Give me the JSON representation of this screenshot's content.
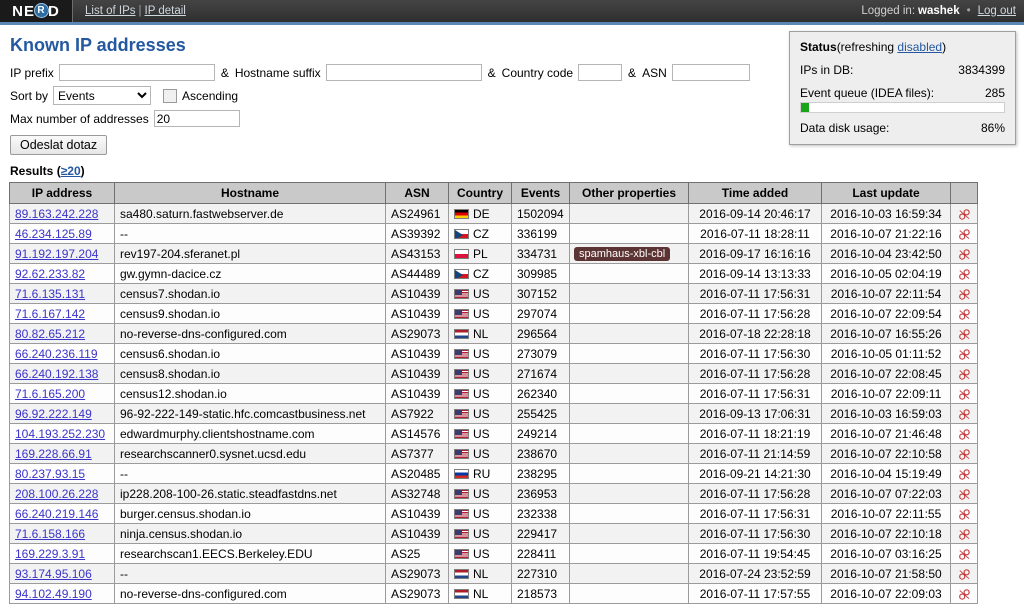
{
  "topbar": {
    "logo_left": "NE",
    "logo_ring": "R",
    "logo_right": "D",
    "nav": [
      {
        "label": "List of IPs"
      },
      {
        "label": "IP detail"
      }
    ],
    "nav_separator": "|",
    "logged_in_label": "Logged in:",
    "username": "washek",
    "dot": "•",
    "logout_label": "Log out"
  },
  "page": {
    "title": "Known IP addresses"
  },
  "form": {
    "ip_prefix_label": "IP prefix",
    "ip_prefix_value": "",
    "amp1": "&",
    "hostname_suffix_label": "Hostname suffix",
    "hostname_suffix_value": "",
    "amp2": "&",
    "country_code_label": "Country code",
    "country_code_value": "",
    "amp3": "&",
    "asn_label": "ASN",
    "asn_value": "",
    "sort_by_label": "Sort by",
    "sort_by_value": "Events",
    "sort_by_options": [
      "Events"
    ],
    "ascending_label": "Ascending",
    "ascending_checked": false,
    "max_addresses_label": "Max number of addresses",
    "max_addresses_value": "20",
    "submit_label": "Odeslat dotaz"
  },
  "results": {
    "heading_label": "Results",
    "count_label": "(≥20)",
    "count_link_text": "≥20"
  },
  "status": {
    "title": "Status",
    "refreshing_prefix": "(refreshing ",
    "refreshing_link": "disabled",
    "refreshing_suffix": ")",
    "ips_in_db_label": "IPs in DB:",
    "ips_in_db_value": "3834399",
    "event_queue_label": "Event queue (IDEA files):",
    "event_queue_value": "285",
    "event_queue_fill_percent": 4,
    "disk_usage_label": "Data disk usage:",
    "disk_usage_value": "86%"
  },
  "table": {
    "columns": [
      "IP address",
      "Hostname",
      "ASN",
      "Country",
      "Events",
      "Other properties",
      "Time added",
      "Last update",
      ""
    ],
    "action_icon": "unlink-icon",
    "rows": [
      {
        "ip": "89.163.242.228",
        "hostname": "sa480.saturn.fastwebserver.de",
        "asn": "AS24961",
        "country": "DE",
        "events": "1502094",
        "props": "",
        "added": "2016-09-14 20:46:17",
        "updated": "2016-10-03 16:59:34"
      },
      {
        "ip": "46.234.125.89",
        "hostname": "--",
        "asn": "AS39392",
        "country": "CZ",
        "events": "336199",
        "props": "",
        "added": "2016-07-11 18:28:11",
        "updated": "2016-10-07 21:22:16"
      },
      {
        "ip": "91.192.197.204",
        "hostname": "rev197-204.sferanet.pl",
        "asn": "AS43153",
        "country": "PL",
        "events": "334731",
        "props": "spamhaus-xbl-cbl",
        "added": "2016-09-17 16:16:16",
        "updated": "2016-10-04 23:42:50"
      },
      {
        "ip": "92.62.233.82",
        "hostname": "gw.gymn-dacice.cz",
        "asn": "AS44489",
        "country": "CZ",
        "events": "309985",
        "props": "",
        "added": "2016-09-14 13:13:33",
        "updated": "2016-10-05 02:04:19"
      },
      {
        "ip": "71.6.135.131",
        "hostname": "census7.shodan.io",
        "asn": "AS10439",
        "country": "US",
        "events": "307152",
        "props": "",
        "added": "2016-07-11 17:56:31",
        "updated": "2016-10-07 22:11:54"
      },
      {
        "ip": "71.6.167.142",
        "hostname": "census9.shodan.io",
        "asn": "AS10439",
        "country": "US",
        "events": "297074",
        "props": "",
        "added": "2016-07-11 17:56:28",
        "updated": "2016-10-07 22:09:54"
      },
      {
        "ip": "80.82.65.212",
        "hostname": "no-reverse-dns-configured.com",
        "asn": "AS29073",
        "country": "NL",
        "events": "296564",
        "props": "",
        "added": "2016-07-18 22:28:18",
        "updated": "2016-10-07 16:55:26"
      },
      {
        "ip": "66.240.236.119",
        "hostname": "census6.shodan.io",
        "asn": "AS10439",
        "country": "US",
        "events": "273079",
        "props": "",
        "added": "2016-07-11 17:56:30",
        "updated": "2016-10-05 01:11:52"
      },
      {
        "ip": "66.240.192.138",
        "hostname": "census8.shodan.io",
        "asn": "AS10439",
        "country": "US",
        "events": "271674",
        "props": "",
        "added": "2016-07-11 17:56:28",
        "updated": "2016-10-07 22:08:45"
      },
      {
        "ip": "71.6.165.200",
        "hostname": "census12.shodan.io",
        "asn": "AS10439",
        "country": "US",
        "events": "262340",
        "props": "",
        "added": "2016-07-11 17:56:31",
        "updated": "2016-10-07 22:09:11"
      },
      {
        "ip": "96.92.222.149",
        "hostname": "96-92-222-149-static.hfc.comcastbusiness.net",
        "asn": "AS7922",
        "country": "US",
        "events": "255425",
        "props": "",
        "added": "2016-09-13 17:06:31",
        "updated": "2016-10-03 16:59:03"
      },
      {
        "ip": "104.193.252.230",
        "hostname": "edwardmurphy.clientshostname.com",
        "asn": "AS14576",
        "country": "US",
        "events": "249214",
        "props": "",
        "added": "2016-07-11 18:21:19",
        "updated": "2016-10-07 21:46:48"
      },
      {
        "ip": "169.228.66.91",
        "hostname": "researchscanner0.sysnet.ucsd.edu",
        "asn": "AS7377",
        "country": "US",
        "events": "238670",
        "props": "",
        "added": "2016-07-11 21:14:59",
        "updated": "2016-10-07 22:10:58"
      },
      {
        "ip": "80.237.93.15",
        "hostname": "--",
        "asn": "AS20485",
        "country": "RU",
        "events": "238295",
        "props": "",
        "added": "2016-09-21 14:21:30",
        "updated": "2016-10-04 15:19:49"
      },
      {
        "ip": "208.100.26.228",
        "hostname": "ip228.208-100-26.static.steadfastdns.net",
        "asn": "AS32748",
        "country": "US",
        "events": "236953",
        "props": "",
        "added": "2016-07-11 17:56:28",
        "updated": "2016-10-07 07:22:03"
      },
      {
        "ip": "66.240.219.146",
        "hostname": "burger.census.shodan.io",
        "asn": "AS10439",
        "country": "US",
        "events": "232338",
        "props": "",
        "added": "2016-07-11 17:56:31",
        "updated": "2016-10-07 22:11:55"
      },
      {
        "ip": "71.6.158.166",
        "hostname": "ninja.census.shodan.io",
        "asn": "AS10439",
        "country": "US",
        "events": "229417",
        "props": "",
        "added": "2016-07-11 17:56:30",
        "updated": "2016-10-07 22:10:18"
      },
      {
        "ip": "169.229.3.91",
        "hostname": "researchscan1.EECS.Berkeley.EDU",
        "asn": "AS25",
        "country": "US",
        "events": "228411",
        "props": "",
        "added": "2016-07-11 19:54:45",
        "updated": "2016-10-07 03:16:25"
      },
      {
        "ip": "93.174.95.106",
        "hostname": "--",
        "asn": "AS29073",
        "country": "NL",
        "events": "227310",
        "props": "",
        "added": "2016-07-24 23:52:59",
        "updated": "2016-10-07 21:58:50"
      },
      {
        "ip": "94.102.49.190",
        "hostname": "no-reverse-dns-configured.com",
        "asn": "AS29073",
        "country": "NL",
        "events": "218573",
        "props": "",
        "added": "2016-07-11 17:57:55",
        "updated": "2016-10-07 22:09:03"
      }
    ]
  },
  "colors": {
    "accent": "#2458a0",
    "navbar": "#3a3a3a",
    "navbar_underline": "#5b87b5",
    "link": "#3b34c9",
    "badge": "#5d3434",
    "queue_fill": "#19a419"
  }
}
